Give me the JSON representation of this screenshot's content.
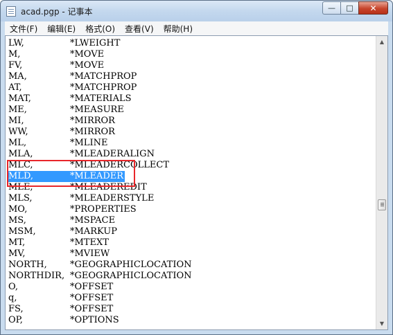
{
  "window": {
    "title": "acad.pgp - 记事本",
    "minimize_glyph": "—",
    "maximize_glyph": "□",
    "close_glyph": "✕"
  },
  "menu": {
    "items": [
      {
        "label": "文件(F)"
      },
      {
        "label": "编辑(E)"
      },
      {
        "label": "格式(O)"
      },
      {
        "label": "查看(V)"
      },
      {
        "label": "帮助(H)"
      }
    ]
  },
  "editor": {
    "lines": [
      {
        "alias": "LW,",
        "command": "*LWEIGHT"
      },
      {
        "alias": "M,",
        "command": "*MOVE"
      },
      {
        "alias": "FV,",
        "command": "*MOVE"
      },
      {
        "alias": "MA,",
        "command": "*MATCHPROP"
      },
      {
        "alias": "AT,",
        "command": "*MATCHPROP"
      },
      {
        "alias": "MAT,",
        "command": "*MATERIALS"
      },
      {
        "alias": "ME,",
        "command": "*MEASURE"
      },
      {
        "alias": "MI,",
        "command": "*MIRROR"
      },
      {
        "alias": "WW,",
        "command": "*MIRROR"
      },
      {
        "alias": "ML,",
        "command": "*MLINE"
      },
      {
        "alias": "MLA,",
        "command": "*MLEADERALIGN"
      },
      {
        "alias": "MLC,",
        "command": "*MLEADERCOLLECT"
      },
      {
        "alias": "MLD,",
        "command": "*MLEADER"
      },
      {
        "alias": "MLE,",
        "command": "*MLEADEREDIT"
      },
      {
        "alias": "MLS,",
        "command": "*MLEADERSTYLE"
      },
      {
        "alias": "MO,",
        "command": "*PROPERTIES"
      },
      {
        "alias": "MS,",
        "command": "*MSPACE"
      },
      {
        "alias": "MSM,",
        "command": "*MARKUP"
      },
      {
        "alias": "MT,",
        "command": "*MTEXT"
      },
      {
        "alias": "MV,",
        "command": "*MVIEW"
      },
      {
        "alias": "NORTH,",
        "command": "*GEOGRAPHICLOCATION"
      },
      {
        "alias": "NORTHDIR,",
        "command": "*GEOGRAPHICLOCATION"
      },
      {
        "alias": "O,",
        "command": "*OFFSET"
      },
      {
        "alias": "q,",
        "command": "*OFFSET"
      },
      {
        "alias": "FS,",
        "command": "*OFFSET"
      },
      {
        "alias": "OP,",
        "command": "*OPTIONS"
      }
    ],
    "selected_line": "MLD,",
    "highlight_color": "#e8262a",
    "selection_color": "#3399ff"
  },
  "scrollbar": {
    "up_glyph": "▲",
    "down_glyph": "▼"
  }
}
